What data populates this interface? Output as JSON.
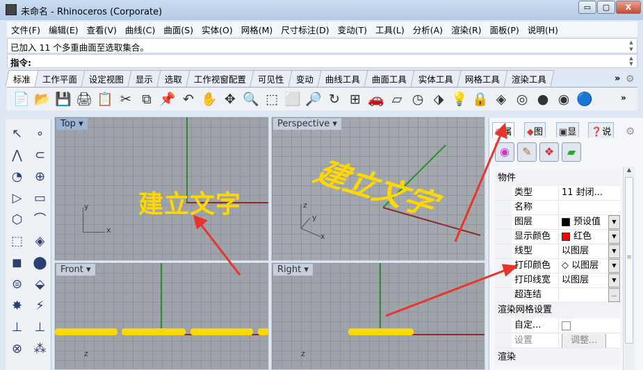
{
  "window": {
    "title": "未命名 - Rhinoceros (Corporate)",
    "min": "▭",
    "max": "▢",
    "close": "X"
  },
  "menu": [
    "文件(F)",
    "编辑(E)",
    "查看(V)",
    "曲线(C)",
    "曲面(S)",
    "实体(O)",
    "网格(M)",
    "尺寸标注(D)",
    "变动(T)",
    "工具(L)",
    "分析(A)",
    "渲染(R)",
    "面板(P)",
    "说明(H)"
  ],
  "command": {
    "history": "已加入 11 个多重曲面至选取集合。",
    "prompt": "指令:",
    "value": ""
  },
  "tabs": [
    "标准",
    "工作平面",
    "设定视图",
    "显示",
    "选取",
    "工作视窗配置",
    "可见性",
    "变动",
    "曲线工具",
    "曲面工具",
    "实体工具",
    "网格工具",
    "渲染工具"
  ],
  "tabs_more": "»",
  "toolbar_icons": [
    "📄",
    "📂",
    "💾",
    "🖨",
    "📋",
    "✂",
    "⧉",
    "📌",
    "↶",
    "✋",
    "✥",
    "🔍",
    "⬚",
    "⬜",
    "🔎",
    "↻",
    "⊞",
    "🚗",
    "▱",
    "◷",
    "⬗",
    "💡",
    "🔒",
    "◈",
    "◎",
    "●",
    "◉",
    "🔵"
  ],
  "left_toolbar": [
    "↖",
    "∘",
    "⋀",
    "⊂",
    "◔",
    "⊕",
    "▷",
    "▭",
    "⬡",
    "⌒",
    "⬚",
    "◈",
    "◼",
    "⬤",
    "⊜",
    "⬙",
    "✸",
    "⚡",
    "⊥",
    "⊥",
    "⊗",
    "⁂"
  ],
  "viewports": [
    {
      "name": "Top",
      "axes": [
        "y",
        "x"
      ]
    },
    {
      "name": "Perspective",
      "axes": [
        "z",
        "y",
        "x"
      ]
    },
    {
      "name": "Front",
      "axes": [
        "z"
      ]
    },
    {
      "name": "Right",
      "axes": [
        "z"
      ]
    }
  ],
  "text_object": "建立文字",
  "panel": {
    "tabs": [
      "属",
      "图",
      "显",
      "说"
    ],
    "tab_icons": [
      "◉",
      "◆",
      "▣",
      "❓"
    ],
    "buttons": [
      "◉",
      "✎",
      "❖",
      "▰"
    ],
    "section_object": "物件",
    "rows": [
      {
        "key": "类型",
        "value": "11 封闭..."
      },
      {
        "key": "名称",
        "value": ""
      },
      {
        "key": "图层",
        "value": "预设值",
        "swatch": "#000000",
        "dropdown": true
      },
      {
        "key": "显示颜色",
        "value": "红色",
        "swatch": "#ff0000",
        "dropdown": true
      },
      {
        "key": "线型",
        "value": "以图层",
        "dropdown": true
      },
      {
        "key": "打印颜色",
        "value": "◇ 以图层",
        "dropdown": true
      },
      {
        "key": "打印线宽",
        "value": "以图层",
        "dropdown": true
      },
      {
        "key": "超连结",
        "value": "",
        "ellipsis": "..."
      }
    ],
    "section_mesh": "渲染网格设置",
    "mesh_rows": [
      {
        "key": "自定..."
      },
      {
        "key": "设置",
        "button": "调整..."
      }
    ],
    "section_render": "渲染"
  },
  "colors": {
    "accent": "#ffd800",
    "axis_x": "#8b2a2a",
    "axis_y": "#2e8b2e",
    "arrow": "#e8352a"
  }
}
